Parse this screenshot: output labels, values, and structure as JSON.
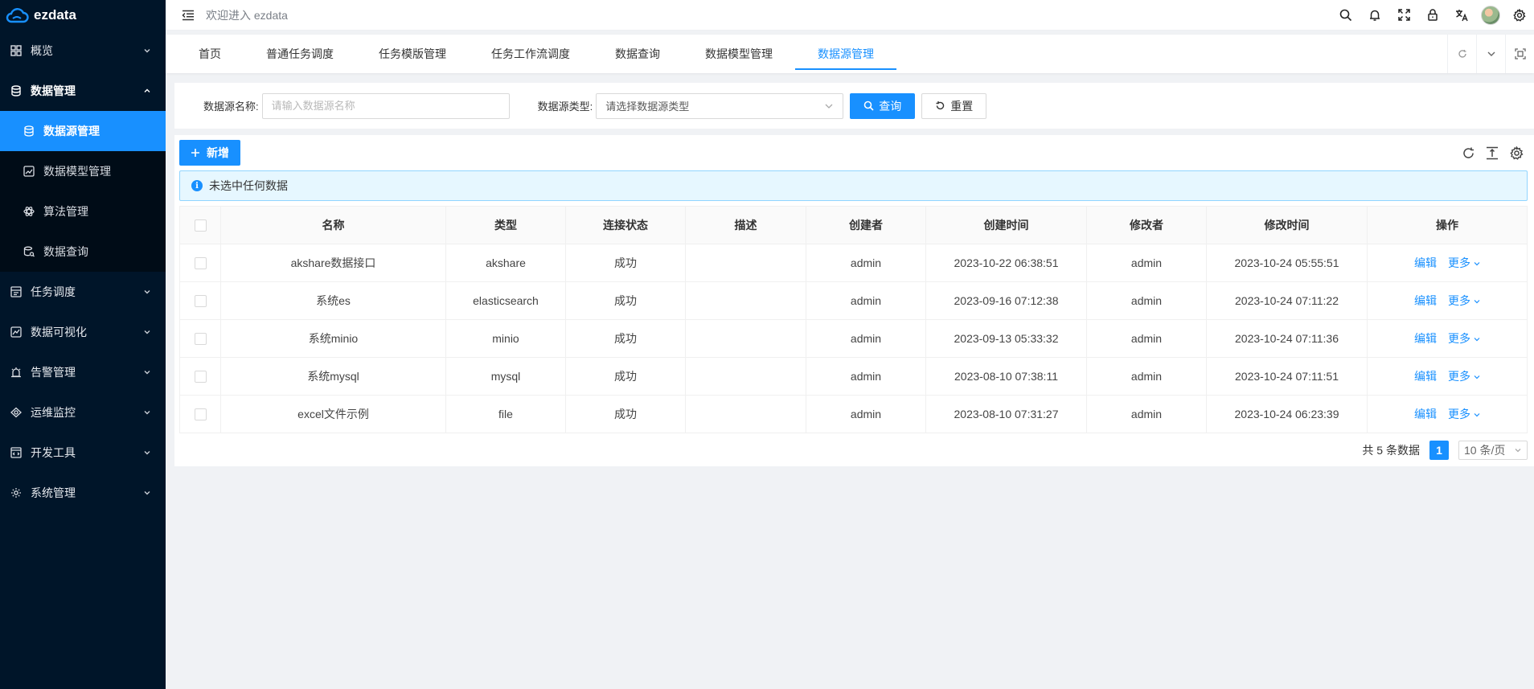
{
  "app": {
    "name": "ezdata"
  },
  "header": {
    "welcome": "欢迎进入 ezdata"
  },
  "sidebar": {
    "items": [
      {
        "label": "概览",
        "open": false
      },
      {
        "label": "数据管理",
        "open": true,
        "children": [
          {
            "label": "数据源管理",
            "active": true
          },
          {
            "label": "数据模型管理"
          },
          {
            "label": "算法管理"
          },
          {
            "label": "数据查询"
          }
        ]
      },
      {
        "label": "任务调度"
      },
      {
        "label": "数据可视化"
      },
      {
        "label": "告警管理"
      },
      {
        "label": "运维监控"
      },
      {
        "label": "开发工具"
      },
      {
        "label": "系统管理"
      }
    ]
  },
  "tabs": [
    {
      "label": "首页"
    },
    {
      "label": "普通任务调度"
    },
    {
      "label": "任务模版管理"
    },
    {
      "label": "任务工作流调度"
    },
    {
      "label": "数据查询"
    },
    {
      "label": "数据模型管理"
    },
    {
      "label": "数据源管理",
      "active": true
    }
  ],
  "search": {
    "name_label": "数据源名称:",
    "name_placeholder": "请输入数据源名称",
    "type_label": "数据源类型:",
    "type_placeholder": "请选择数据源类型",
    "query_label": "查询",
    "reset_label": "重置"
  },
  "toolbar": {
    "add_label": "新增"
  },
  "alert": {
    "text": "未选中任何数据"
  },
  "table": {
    "columns": [
      "名称",
      "类型",
      "连接状态",
      "描述",
      "创建者",
      "创建时间",
      "修改者",
      "修改时间",
      "操作"
    ],
    "rows": [
      {
        "name": "akshare数据接口",
        "type": "akshare",
        "status": "成功",
        "desc": "",
        "creator": "admin",
        "created": "2023-10-22 06:38:51",
        "modifier": "admin",
        "modified": "2023-10-24 05:55:51"
      },
      {
        "name": "系统es",
        "type": "elasticsearch",
        "status": "成功",
        "desc": "",
        "creator": "admin",
        "created": "2023-09-16 07:12:38",
        "modifier": "admin",
        "modified": "2023-10-24 07:11:22"
      },
      {
        "name": "系统minio",
        "type": "minio",
        "status": "成功",
        "desc": "",
        "creator": "admin",
        "created": "2023-09-13 05:33:32",
        "modifier": "admin",
        "modified": "2023-10-24 07:11:36"
      },
      {
        "name": "系统mysql",
        "type": "mysql",
        "status": "成功",
        "desc": "",
        "creator": "admin",
        "created": "2023-08-10 07:38:11",
        "modifier": "admin",
        "modified": "2023-10-24 07:11:51"
      },
      {
        "name": "excel文件示例",
        "type": "file",
        "status": "成功",
        "desc": "",
        "creator": "admin",
        "created": "2023-08-10 07:31:27",
        "modifier": "admin",
        "modified": "2023-10-24 06:23:39"
      }
    ],
    "edit_label": "编辑",
    "more_label": "更多"
  },
  "pagination": {
    "total_text": "共 5 条数据",
    "current_page": "1",
    "page_size": "10 条/页"
  },
  "colors": {
    "primary": "#1890ff",
    "sidebar_bg": "#001529",
    "alert_bg": "#e6f7ff"
  }
}
